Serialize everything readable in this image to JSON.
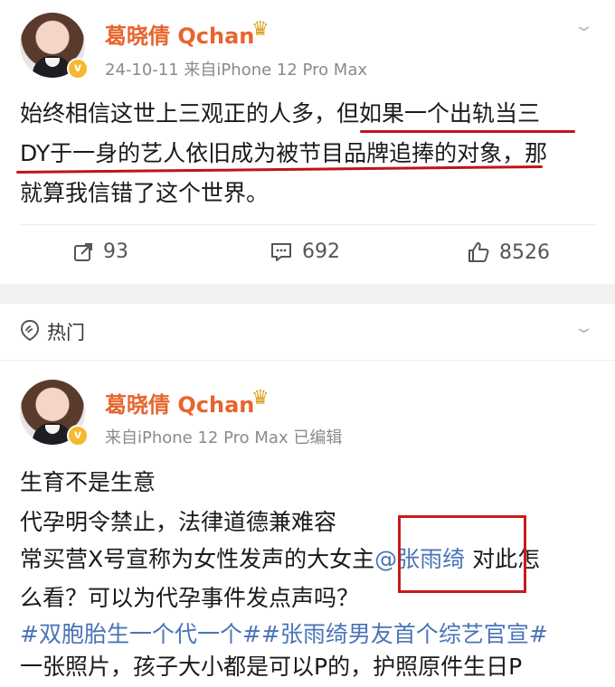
{
  "post1": {
    "username": "葛晓倩 Qchan",
    "crown_icon": "crown-icon",
    "meta": "24-10-11  来自iPhone 12 Pro Max",
    "body_lines": [
      "始终相信这世上三观正的人多，但如果一个出轨当三",
      "DY于一身的艺人依旧成为被节目品牌追捧的对象，那",
      "就算我信错了这个世界。"
    ],
    "actions": {
      "repost": "93",
      "comment": "692",
      "like": "8526"
    }
  },
  "section": {
    "label": "热门"
  },
  "post2": {
    "username": "葛晓倩 Qchan",
    "meta": "来自iPhone 12 Pro Max  已编辑",
    "line1": "生育不是生意",
    "line2": "代孕明令禁止，法律道德兼难容",
    "line3_pre": "常买营X号宣称为女性发声的大女主",
    "mention": "@张雨绮",
    "line3_post": " 对此怎",
    "line4": "么看？可以为代孕事件发点声吗？",
    "hashtags": "#双胞胎生一个代一个##张雨绮男友首个综艺官宣#",
    "line6": "一张照片，孩子大小都是可以P的，护照原件生日P"
  },
  "colors": {
    "username": "#e8642e",
    "link": "#4a74b8",
    "annotation_red": "#c0131b",
    "verified": "#f5b82e"
  }
}
